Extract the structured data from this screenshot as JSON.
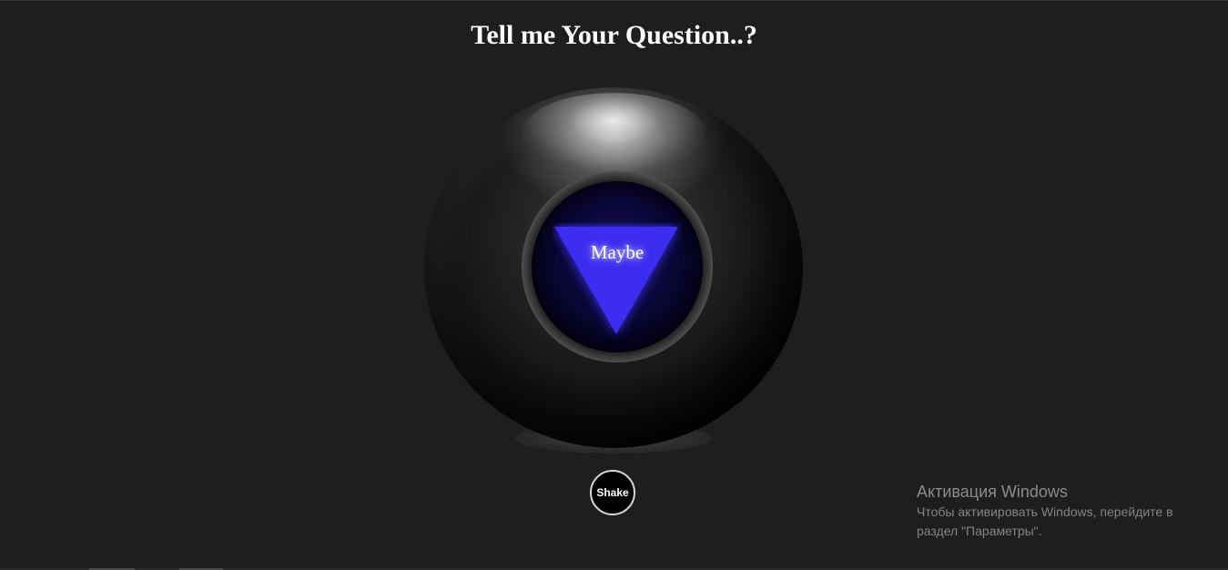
{
  "header": {
    "title": "Tell me Your Question..?"
  },
  "ball": {
    "answer": "Maybe",
    "triangle_color": "#3b2ef0"
  },
  "controls": {
    "shake_label": "Shake"
  },
  "windows_activation": {
    "title": "Активация Windows",
    "line1": "Чтобы активировать Windows, перейдите в",
    "line2": "раздел \"Параметры\"."
  },
  "colors": {
    "background": "#1e1e1e",
    "title_text": "#ffffff"
  }
}
